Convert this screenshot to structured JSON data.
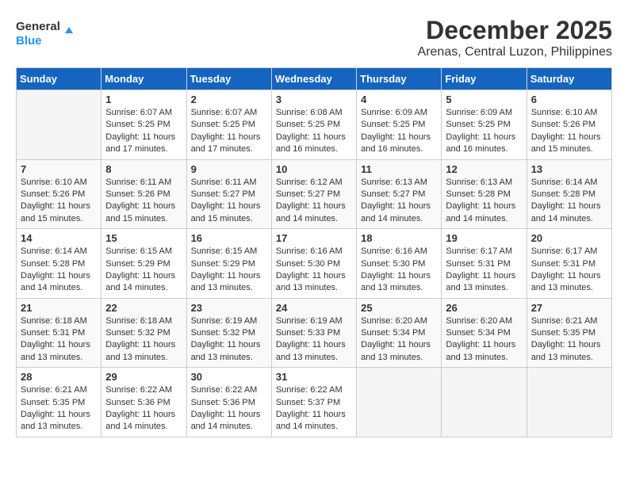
{
  "header": {
    "logo_line1": "General",
    "logo_line2": "Blue",
    "title": "December 2025",
    "subtitle": "Arenas, Central Luzon, Philippines"
  },
  "calendar": {
    "days_of_week": [
      "Sunday",
      "Monday",
      "Tuesday",
      "Wednesday",
      "Thursday",
      "Friday",
      "Saturday"
    ],
    "weeks": [
      [
        {
          "day": "",
          "sunrise": "",
          "sunset": "",
          "daylight": ""
        },
        {
          "day": "1",
          "sunrise": "6:07 AM",
          "sunset": "5:25 PM",
          "daylight": "11 hours and 17 minutes."
        },
        {
          "day": "2",
          "sunrise": "6:07 AM",
          "sunset": "5:25 PM",
          "daylight": "11 hours and 17 minutes."
        },
        {
          "day": "3",
          "sunrise": "6:08 AM",
          "sunset": "5:25 PM",
          "daylight": "11 hours and 16 minutes."
        },
        {
          "day": "4",
          "sunrise": "6:09 AM",
          "sunset": "5:25 PM",
          "daylight": "11 hours and 16 minutes."
        },
        {
          "day": "5",
          "sunrise": "6:09 AM",
          "sunset": "5:25 PM",
          "daylight": "11 hours and 16 minutes."
        },
        {
          "day": "6",
          "sunrise": "6:10 AM",
          "sunset": "5:26 PM",
          "daylight": "11 hours and 15 minutes."
        }
      ],
      [
        {
          "day": "7",
          "sunrise": "6:10 AM",
          "sunset": "5:26 PM",
          "daylight": "11 hours and 15 minutes."
        },
        {
          "day": "8",
          "sunrise": "6:11 AM",
          "sunset": "5:26 PM",
          "daylight": "11 hours and 15 minutes."
        },
        {
          "day": "9",
          "sunrise": "6:11 AM",
          "sunset": "5:27 PM",
          "daylight": "11 hours and 15 minutes."
        },
        {
          "day": "10",
          "sunrise": "6:12 AM",
          "sunset": "5:27 PM",
          "daylight": "11 hours and 14 minutes."
        },
        {
          "day": "11",
          "sunrise": "6:13 AM",
          "sunset": "5:27 PM",
          "daylight": "11 hours and 14 minutes."
        },
        {
          "day": "12",
          "sunrise": "6:13 AM",
          "sunset": "5:28 PM",
          "daylight": "11 hours and 14 minutes."
        },
        {
          "day": "13",
          "sunrise": "6:14 AM",
          "sunset": "5:28 PM",
          "daylight": "11 hours and 14 minutes."
        }
      ],
      [
        {
          "day": "14",
          "sunrise": "6:14 AM",
          "sunset": "5:28 PM",
          "daylight": "11 hours and 14 minutes."
        },
        {
          "day": "15",
          "sunrise": "6:15 AM",
          "sunset": "5:29 PM",
          "daylight": "11 hours and 14 minutes."
        },
        {
          "day": "16",
          "sunrise": "6:15 AM",
          "sunset": "5:29 PM",
          "daylight": "11 hours and 13 minutes."
        },
        {
          "day": "17",
          "sunrise": "6:16 AM",
          "sunset": "5:30 PM",
          "daylight": "11 hours and 13 minutes."
        },
        {
          "day": "18",
          "sunrise": "6:16 AM",
          "sunset": "5:30 PM",
          "daylight": "11 hours and 13 minutes."
        },
        {
          "day": "19",
          "sunrise": "6:17 AM",
          "sunset": "5:31 PM",
          "daylight": "11 hours and 13 minutes."
        },
        {
          "day": "20",
          "sunrise": "6:17 AM",
          "sunset": "5:31 PM",
          "daylight": "11 hours and 13 minutes."
        }
      ],
      [
        {
          "day": "21",
          "sunrise": "6:18 AM",
          "sunset": "5:31 PM",
          "daylight": "11 hours and 13 minutes."
        },
        {
          "day": "22",
          "sunrise": "6:18 AM",
          "sunset": "5:32 PM",
          "daylight": "11 hours and 13 minutes."
        },
        {
          "day": "23",
          "sunrise": "6:19 AM",
          "sunset": "5:32 PM",
          "daylight": "11 hours and 13 minutes."
        },
        {
          "day": "24",
          "sunrise": "6:19 AM",
          "sunset": "5:33 PM",
          "daylight": "11 hours and 13 minutes."
        },
        {
          "day": "25",
          "sunrise": "6:20 AM",
          "sunset": "5:34 PM",
          "daylight": "11 hours and 13 minutes."
        },
        {
          "day": "26",
          "sunrise": "6:20 AM",
          "sunset": "5:34 PM",
          "daylight": "11 hours and 13 minutes."
        },
        {
          "day": "27",
          "sunrise": "6:21 AM",
          "sunset": "5:35 PM",
          "daylight": "11 hours and 13 minutes."
        }
      ],
      [
        {
          "day": "28",
          "sunrise": "6:21 AM",
          "sunset": "5:35 PM",
          "daylight": "11 hours and 13 minutes."
        },
        {
          "day": "29",
          "sunrise": "6:22 AM",
          "sunset": "5:36 PM",
          "daylight": "11 hours and 14 minutes."
        },
        {
          "day": "30",
          "sunrise": "6:22 AM",
          "sunset": "5:36 PM",
          "daylight": "11 hours and 14 minutes."
        },
        {
          "day": "31",
          "sunrise": "6:22 AM",
          "sunset": "5:37 PM",
          "daylight": "11 hours and 14 minutes."
        },
        {
          "day": "",
          "sunrise": "",
          "sunset": "",
          "daylight": ""
        },
        {
          "day": "",
          "sunrise": "",
          "sunset": "",
          "daylight": ""
        },
        {
          "day": "",
          "sunrise": "",
          "sunset": "",
          "daylight": ""
        }
      ]
    ]
  }
}
